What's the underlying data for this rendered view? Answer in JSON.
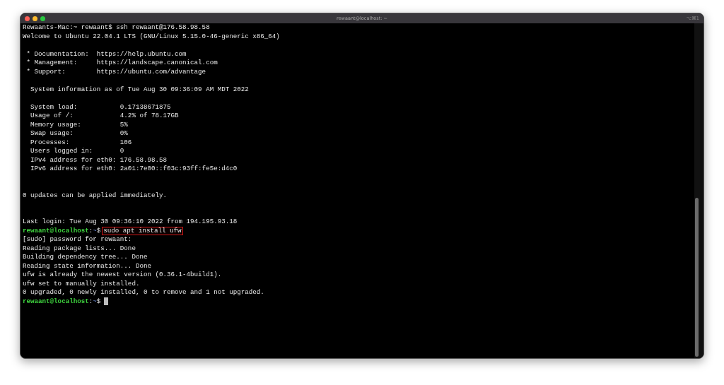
{
  "window": {
    "title": "rewaant@localhost: ~",
    "shortcut": "⌥⌘1"
  },
  "lines": [
    {
      "kind": "plain",
      "text": "Rewaants-Mac:~ rewaant$ ssh rewaant@176.58.98.58"
    },
    {
      "kind": "plain",
      "text": "Welcome to Ubuntu 22.04.1 LTS (GNU/Linux 5.15.0-46-generic x86_64)"
    },
    {
      "kind": "blank"
    },
    {
      "kind": "plain",
      "text": " * Documentation:  https://help.ubuntu.com"
    },
    {
      "kind": "plain",
      "text": " * Management:     https://landscape.canonical.com"
    },
    {
      "kind": "plain",
      "text": " * Support:        https://ubuntu.com/advantage"
    },
    {
      "kind": "blank"
    },
    {
      "kind": "plain",
      "text": "  System information as of Tue Aug 30 09:36:09 AM MDT 2022"
    },
    {
      "kind": "blank"
    },
    {
      "kind": "plain",
      "text": "  System load:           0.17138671875"
    },
    {
      "kind": "plain",
      "text": "  Usage of /:            4.2% of 78.17GB"
    },
    {
      "kind": "plain",
      "text": "  Memory usage:          5%"
    },
    {
      "kind": "plain",
      "text": "  Swap usage:            0%"
    },
    {
      "kind": "plain",
      "text": "  Processes:             106"
    },
    {
      "kind": "plain",
      "text": "  Users logged in:       0"
    },
    {
      "kind": "plain",
      "text": "  IPv4 address for eth0: 176.58.98.58"
    },
    {
      "kind": "plain",
      "text": "  IPv6 address for eth0: 2a01:7e00::f03c:93ff:fe5e:d4c0"
    },
    {
      "kind": "blank"
    },
    {
      "kind": "blank"
    },
    {
      "kind": "plain",
      "text": "0 updates can be applied immediately."
    },
    {
      "kind": "blank"
    },
    {
      "kind": "blank"
    },
    {
      "kind": "plain",
      "text": "Last login: Tue Aug 30 09:36:10 2022 from 194.195.93.18"
    },
    {
      "kind": "prompt",
      "user": "rewaant@localhost",
      "sep": ":",
      "path": "~",
      "symbol": "$",
      "command": "sudo apt install ufw",
      "highlighted": true,
      "cursor": false
    },
    {
      "kind": "plain",
      "text": "[sudo] password for rewaant:"
    },
    {
      "kind": "plain",
      "text": "Reading package lists... Done"
    },
    {
      "kind": "plain",
      "text": "Building dependency tree... Done"
    },
    {
      "kind": "plain",
      "text": "Reading state information... Done"
    },
    {
      "kind": "plain",
      "text": "ufw is already the newest version (0.36.1-4build1)."
    },
    {
      "kind": "plain",
      "text": "ufw set to manually installed."
    },
    {
      "kind": "plain",
      "text": "0 upgraded, 0 newly installed, 0 to remove and 1 not upgraded."
    },
    {
      "kind": "prompt",
      "user": "rewaant@localhost",
      "sep": ":",
      "path": "~",
      "symbol": "$",
      "cursor": true
    }
  ]
}
